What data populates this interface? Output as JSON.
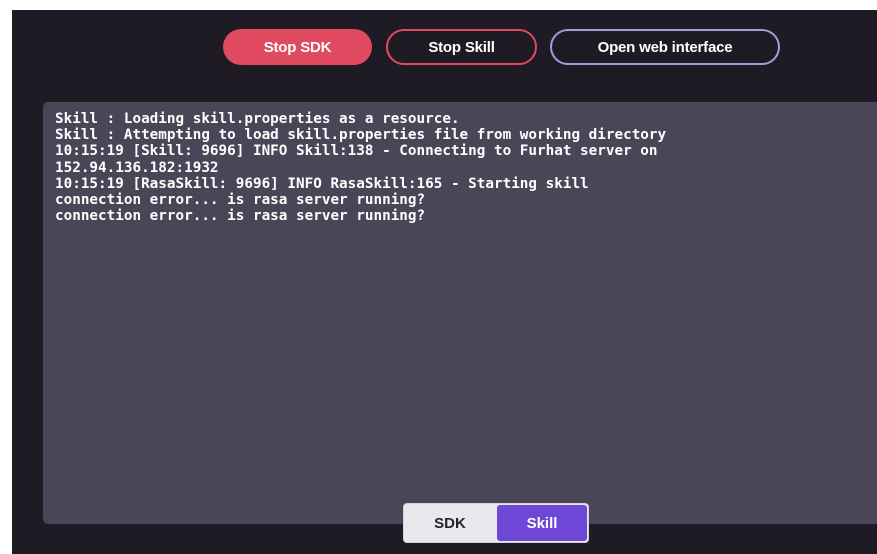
{
  "toolbar": {
    "stop_sdk_label": "Stop SDK",
    "stop_skill_label": "Stop Skill",
    "open_web_label": "Open web interface"
  },
  "log": {
    "lines": [
      "Skill : Loading skill.properties as a resource.",
      "Skill : Attempting to load skill.properties file from working directory",
      "10:15:19 [Skill: 9696] INFO Skill:138 - Connecting to Furhat server on",
      "152.94.136.182:1932",
      "10:15:19 [RasaSkill: 9696] INFO RasaSkill:165 - Starting skill",
      "connection error... is rasa server running?",
      "connection error... is rasa server running?"
    ]
  },
  "tabs": {
    "items": [
      {
        "label": "SDK",
        "active": false
      },
      {
        "label": "Skill",
        "active": true
      }
    ]
  },
  "colors": {
    "background": "#1f1b25",
    "log_background": "#4a4557",
    "stop_accent": "#e04a60",
    "open_web_border": "#a89ad6",
    "active_tab": "#6f47d6"
  }
}
